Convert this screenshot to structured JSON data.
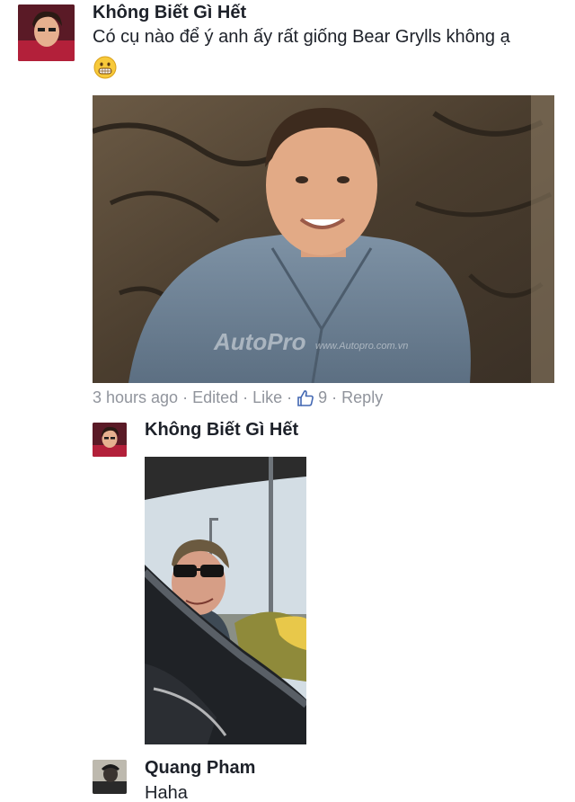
{
  "comment1": {
    "author": "Không Biết Gì Hết",
    "text": "Có cụ nào để ý anh ấy rất giống Bear Grylls không ạ",
    "emoji": "grinning-face",
    "photo_watermark": "AutoPro www.Autopro.com.vn",
    "meta": {
      "time": "3 hours ago",
      "edited": "Edited",
      "like": "Like",
      "like_count": "9",
      "reply": "Reply",
      "separator": "·"
    }
  },
  "reply1": {
    "author": "Không Biết Gì Hết"
  },
  "reply2": {
    "author": "Quang Pham",
    "text": "Haha"
  },
  "colors": {
    "text": "#1d2129",
    "meta": "#90949c",
    "like_icon": "#4267b2"
  }
}
